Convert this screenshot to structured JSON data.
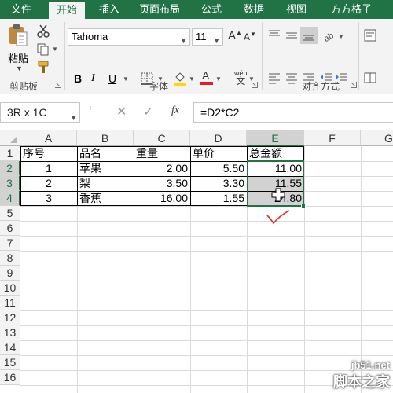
{
  "tabs": [
    {
      "label": "文件",
      "active": false
    },
    {
      "label": "开始",
      "active": true
    },
    {
      "label": "插入",
      "active": false
    },
    {
      "label": "页面布局",
      "active": false
    },
    {
      "label": "公式",
      "active": false
    },
    {
      "label": "数据",
      "active": false
    },
    {
      "label": "视图",
      "active": false
    },
    {
      "label": "方方格子",
      "active": false
    }
  ],
  "ribbon": {
    "clipboard": {
      "paste_label": "粘贴",
      "group_label": "剪贴板"
    },
    "font": {
      "font_name": "Tahoma",
      "font_size": "11",
      "bold": "B",
      "italic": "I",
      "underline": "U",
      "group_label": "字体",
      "phonetic": "wén"
    },
    "alignment": {
      "group_label": "对齐方式"
    }
  },
  "formula_bar": {
    "name_box": "3R x 1C",
    "fx": "fx",
    "formula": "=D2*C2"
  },
  "grid": {
    "columns": [
      "A",
      "B",
      "C",
      "D",
      "E",
      "F",
      "G"
    ],
    "rows": [
      "1",
      "2",
      "3",
      "4",
      "5",
      "6",
      "7",
      "8",
      "9",
      "10",
      "11",
      "12",
      "13",
      "14",
      "15",
      "16"
    ],
    "selected_column": "E",
    "selected_rows": [
      "2",
      "3",
      "4"
    ],
    "table": {
      "headers": [
        "序号",
        "品名",
        "重量",
        "单价",
        "总金额"
      ],
      "rows": [
        [
          "1",
          "苹果",
          "2.00",
          "5.50",
          "11.00"
        ],
        [
          "2",
          "梨",
          "3.50",
          "3.30",
          "11.55"
        ],
        [
          "3",
          "香蕉",
          "16.00",
          "1.55",
          "24.80"
        ]
      ]
    }
  },
  "colors": {
    "accent": "#217346",
    "ribbon_bg": "#f3f3f3",
    "selection": "#d2d2d2",
    "check_mark": "#e03030"
  },
  "watermark": {
    "url": "jb51.net",
    "name": "脚本之家"
  }
}
